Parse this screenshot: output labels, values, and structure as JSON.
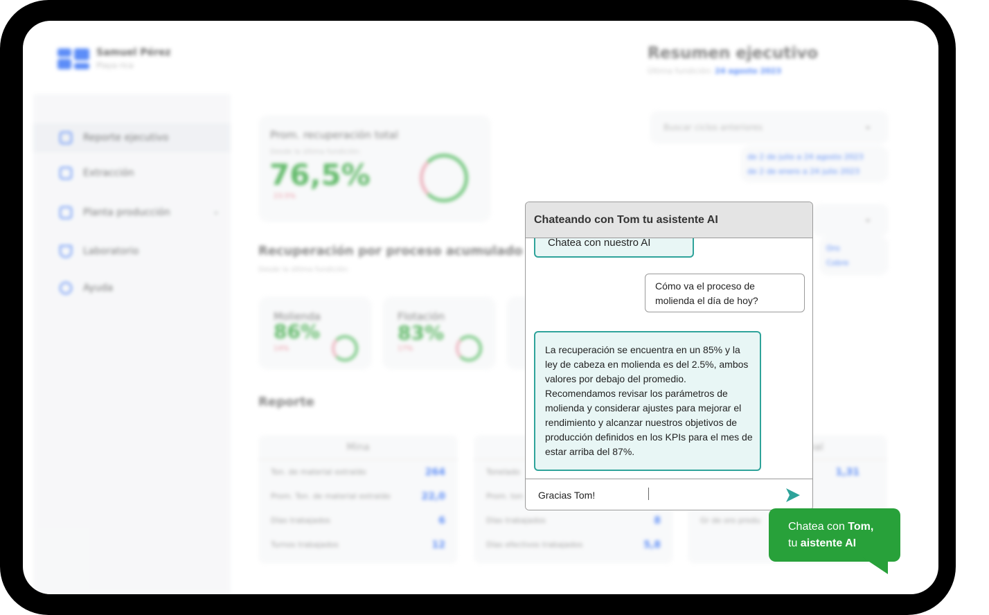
{
  "brand": {
    "name": "Samuel Pérez",
    "subtitle": "Playa rica"
  },
  "header": {
    "title": "Resumen ejecutivo",
    "subtitle_prefix": "Última fundición:",
    "subtitle_date": "24 agosto 2023"
  },
  "sidebar": {
    "items": [
      {
        "label": "Reporte ejecutivo",
        "icon": "clipboard-icon"
      },
      {
        "label": "Extracción",
        "icon": "image-icon"
      },
      {
        "label": "Planta producción",
        "icon": "building-icon"
      },
      {
        "label": "Laboratorio",
        "icon": "flask-icon"
      },
      {
        "label": "Ayuda",
        "icon": "globe-icon"
      }
    ]
  },
  "kpi_total": {
    "title": "Prom. recuperación total",
    "subtitle": "Desde la última fundición:",
    "value": "76,5%",
    "delta": "23.5%"
  },
  "process_section": {
    "title": "Recuperación por proceso acumulado",
    "subtitle": "Desde la última fundición:"
  },
  "process_cards": [
    {
      "title": "Molienda",
      "value": "86%",
      "delta": "14%"
    },
    {
      "title": "Flotación",
      "value": "83%",
      "delta": "17%"
    }
  ],
  "filters": {
    "search_placeholder": "Buscar ciclos anteriores",
    "range_1": "de 2 de julio a 24 agosto 2023",
    "range_2": "de 2 de enero a 24 julio 2023",
    "metal_1": "Oro",
    "metal_2": "Cobre"
  },
  "report": {
    "title": "Reporte",
    "mina": {
      "header": "Mina",
      "rows": [
        {
          "label": "Ton. de material extraído",
          "value": "264"
        },
        {
          "label": "Prom. Ton. de material extraído",
          "value": "22,0"
        },
        {
          "label": "Días trabajados",
          "value": "6"
        },
        {
          "label": "Turnos trabajados",
          "value": "12"
        }
      ]
    },
    "planta": {
      "rows": [
        {
          "label": "Tonelado",
          "value": ""
        },
        {
          "label": "Prom. ton",
          "value": ""
        },
        {
          "label": "Días trabajados",
          "value": "8"
        },
        {
          "label": "Días efectivos trabajados",
          "value": "5,8"
        }
      ]
    },
    "final": {
      "header_fragment": "nal",
      "value": "1,31",
      "row_label": "Gr de oro produ"
    }
  },
  "chat": {
    "title": "Chateando con Tom tu asistente AI",
    "partial_message": "Chatea con nuestro AI",
    "user_message": "Cómo va el proceso de molienda el día de hoy?",
    "ai_message": "La recuperación se encuentra en un 85% y la ley de cabeza en molienda es del 2.5%, ambos valores por debajo del promedio. Recomendamos revisar los parámetros de molienda y considerar ajustes para mejorar el rendimiento y alcanzar nuestros objetivos de producción definidos en los KPIs para el mes de estar arriba del 87%.",
    "input_value": "Gracias Tom!",
    "send_icon": "send-icon"
  },
  "cta": {
    "text_1": "Chatea con ",
    "bold_1": "Tom,",
    "text_2": "tu ",
    "bold_2": "aistente AI"
  },
  "colors": {
    "accent_blue": "#2f6df6",
    "chat_teal": "#2ea39a",
    "cta_green": "#28a13a",
    "kpi_green": "#3aa944"
  }
}
